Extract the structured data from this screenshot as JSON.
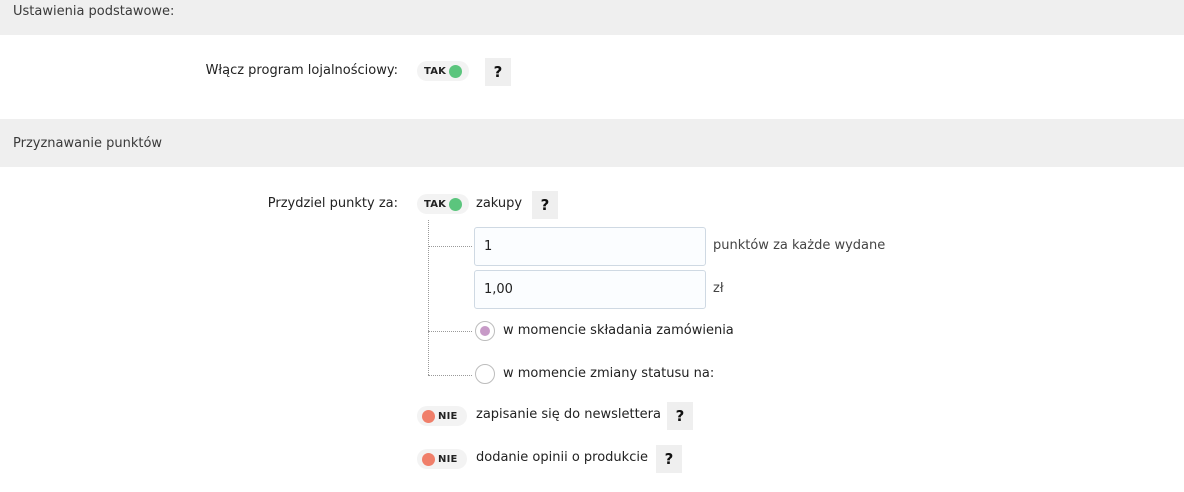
{
  "sections": {
    "basic": {
      "title": "Ustawienia podstawowe:"
    },
    "points": {
      "title": "Przyznawanie punktów"
    }
  },
  "loyalty": {
    "label": "Włącz program lojalnościowy:",
    "toggle": {
      "text": "TAK",
      "state": "on"
    },
    "help": "?"
  },
  "award": {
    "label": "Przydziel punkty za:",
    "purchases": {
      "toggle": {
        "text": "TAK",
        "state": "on"
      },
      "label": "zakupy",
      "help": "?",
      "points_value": "1",
      "points_suffix": "punktów za każde wydane",
      "amount_value": "1,00",
      "amount_suffix": "zł",
      "radio_options": [
        {
          "label": "w momencie składania zamówienia",
          "selected": true
        },
        {
          "label": "w momencie zmiany statusu na:",
          "selected": false
        }
      ]
    },
    "newsletter": {
      "toggle": {
        "text": "NIE",
        "state": "off"
      },
      "label": "zapisanie się do newslettera",
      "help": "?"
    },
    "review": {
      "toggle": {
        "text": "NIE",
        "state": "off"
      },
      "label": "dodanie opinii o produkcie",
      "help": "?"
    }
  },
  "colors": {
    "toggle_on": "#5bc57d",
    "toggle_off": "#f07f6a",
    "radio_selected": "#c79ac7",
    "section_bg": "#efefef"
  }
}
